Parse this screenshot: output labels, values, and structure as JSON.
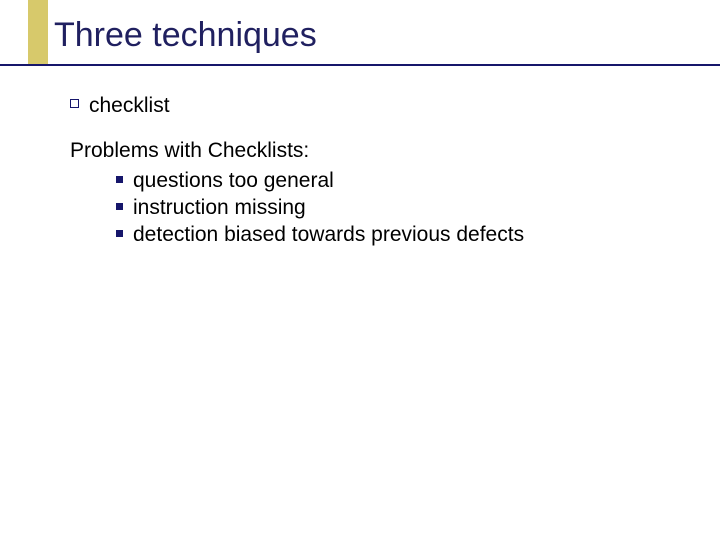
{
  "slide": {
    "title": "Three techniques",
    "item1": "checklist",
    "subheading": "Problems with Checklists:",
    "problems": {
      "p1": "questions too general",
      "p2": "instruction missing",
      "p3": "detection biased towards previous defects"
    }
  }
}
